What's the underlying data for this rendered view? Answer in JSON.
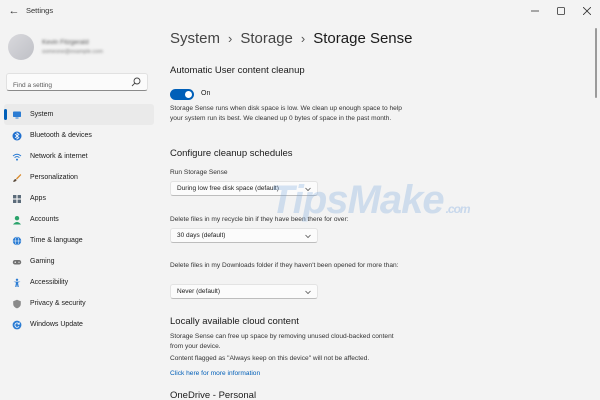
{
  "window": {
    "title": "Settings",
    "controls": [
      "minimize",
      "maximize",
      "close"
    ]
  },
  "profile": {
    "name": "Kevin Fitzgerald",
    "email": "someone@example.com"
  },
  "search": {
    "placeholder": "Find a setting"
  },
  "sidebar": {
    "items": [
      {
        "label": "System",
        "icon": "monitor-icon",
        "color": "#2b7cd3",
        "active": true
      },
      {
        "label": "Bluetooth & devices",
        "icon": "bluetooth-icon",
        "color": "#1f6fce"
      },
      {
        "label": "Network & internet",
        "icon": "wifi-icon",
        "color": "#2b7cd3"
      },
      {
        "label": "Personalization",
        "icon": "brush-icon",
        "color": "#d98a2b"
      },
      {
        "label": "Apps",
        "icon": "apps-icon",
        "color": "#5b6b7a"
      },
      {
        "label": "Accounts",
        "icon": "person-icon",
        "color": "#2aa36b"
      },
      {
        "label": "Time & language",
        "icon": "globe-icon",
        "color": "#2b7cd3"
      },
      {
        "label": "Gaming",
        "icon": "gamepad-icon",
        "color": "#707070"
      },
      {
        "label": "Accessibility",
        "icon": "accessibility-icon",
        "color": "#2b7cd3"
      },
      {
        "label": "Privacy & security",
        "icon": "shield-icon",
        "color": "#8a8a8a"
      },
      {
        "label": "Windows Update",
        "icon": "update-icon",
        "color": "#2b7cd3"
      }
    ]
  },
  "breadcrumb": {
    "items": [
      "System",
      "Storage"
    ],
    "current": "Storage Sense"
  },
  "auto_cleanup": {
    "title": "Automatic User content cleanup",
    "toggle_state": "On",
    "description": "Storage Sense runs when disk space is low. We clean up enough space to help your system run its best. We cleaned up 0 bytes of space in the past month."
  },
  "schedules": {
    "title": "Configure cleanup schedules",
    "run_label": "Run Storage Sense",
    "run_value": "During low free disk space (default)",
    "recycle_label": "Delete files in my recycle bin if they have been there for over:",
    "recycle_value": "30 days (default)",
    "downloads_label": "Delete files in my Downloads folder if they haven't been opened for more than:",
    "downloads_value": "Never (default)"
  },
  "cloud": {
    "title": "Locally available cloud content",
    "description": "Storage Sense can free up space by removing unused cloud-backed content from your device.",
    "note": "Content flagged as \"Always keep on this device\" will not be affected.",
    "link": "Click here for more information",
    "onedrive_title": "OneDrive - Personal"
  },
  "watermark": {
    "brand": "TipsMake",
    "domain": ".com"
  },
  "colors": {
    "accent": "#005fb8",
    "background": "#f3f3f3"
  }
}
